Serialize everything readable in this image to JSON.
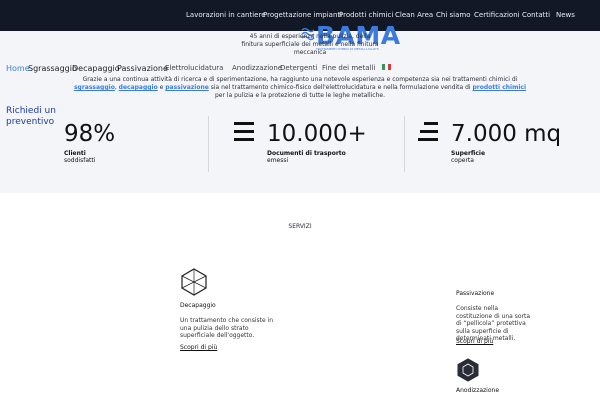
{
  "nav": {
    "items": [
      "Lavorazioni in cantiere",
      "Progettazione impianti",
      "Prodotti chimici",
      "Clean Area",
      "Chi siamo",
      "Certificazioni",
      "Contatti",
      "News"
    ]
  },
  "logo": {
    "text": "BAMA",
    "subtitle": "TRATTAMENTI CHIMICI DI METALLI ALLOYS"
  },
  "hero": {
    "tagline": "45 anni di esperienza nella pulizia, della finitura superficiale dei metalli e nella finitura meccanica",
    "breadcrumb": [
      "Home",
      "Sgrassaggio",
      "Decapaggio",
      "Passivazione",
      "Elettrolucidatura",
      "Anodizzazione",
      "Detergenti",
      "Fine dei metalli"
    ],
    "intro": {
      "part1": "Grazie a una continua attività di ricerca e di sperimentazione, ha raggiunto una notevole esperienza e competenza sia nei trattamenti chimici di ",
      "link1": "sgrassaggio",
      "part2": ", ",
      "link2": "decapaggio",
      "part3": " e ",
      "link3": "passivazione",
      "part4": " sia nel trattamento chimico-fisico dell'elettrolucidatura e nella formulazione vendita di ",
      "link4": "prodotti chimici",
      "part5": " per la pulizia e la protezione di tutte le leghe metalliche."
    },
    "cta": "Richiedi un preventivo"
  },
  "stats": [
    {
      "value": "98%",
      "label": "Clienti",
      "sub": "soddisfatti",
      "icon": "none"
    },
    {
      "value": "10.000+",
      "label": "Documenti di trasporto",
      "sub": "emessi",
      "icon": "menu-lines-icon"
    },
    {
      "value": "7.000 mq",
      "label": "Superficie",
      "sub": "coperta",
      "icon": "align-lines-icon"
    }
  ],
  "services": {
    "heading": "SERVIZI",
    "decapaggio": {
      "title": "Decapaggio",
      "desc": "Un trattamento che consiste in una pulizia dello strato superficiale dell'oggetto.",
      "link": "Scopri di più"
    },
    "passivazione": {
      "title": "Passivazione",
      "desc": "Consiste nella costituzione di una sorta di “pellicola” protettiva sulla superficie di determinati metalli.",
      "link": "Scopri di più"
    },
    "anodizzazione": {
      "title": "Anodizzazione"
    }
  },
  "colors": {
    "nav_bg": "#121826",
    "accent": "#3b7be0",
    "cta": "#1f3aa8",
    "hero_bg": "#f3f5f8"
  }
}
